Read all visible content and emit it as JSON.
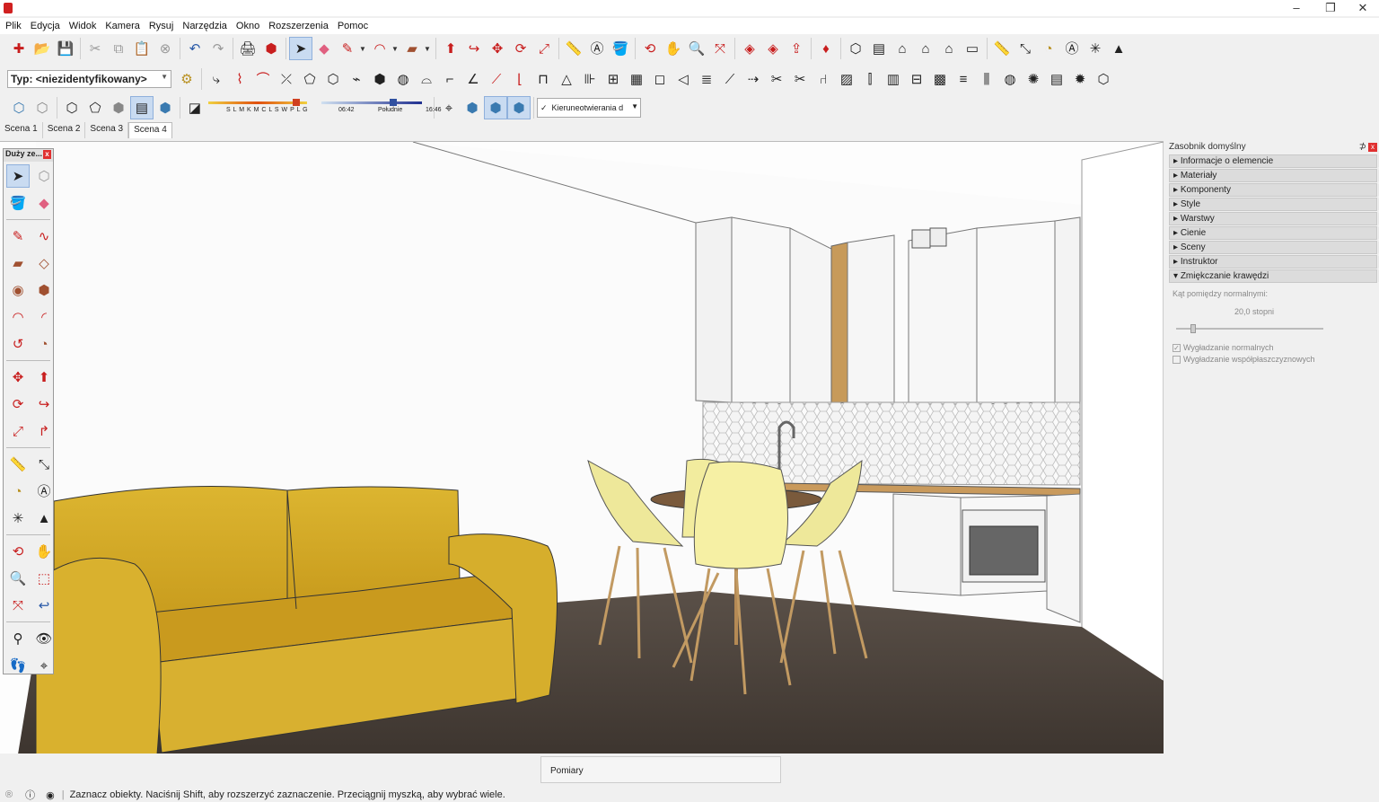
{
  "menu": [
    "Plik",
    "Edycja",
    "Widok",
    "Kamera",
    "Rysuj",
    "Narzędzia",
    "Okno",
    "Rozszerzenia",
    "Pomoc"
  ],
  "window_controls": {
    "minimize": "–",
    "restore": "❐",
    "close": "✕"
  },
  "style_type": "Typ: <niezidentyfikowany>",
  "shadow_slider": {
    "months": "S L M K M C L S W P L G",
    "time_start": "06:42",
    "time_mid": "Południe",
    "time_end": "16:46"
  },
  "section_option": {
    "check": "✓",
    "label": "Kieruneotwierania d"
  },
  "scene_tabs": [
    "Scena 1",
    "Scena 2",
    "Scena 3",
    "Scena 4"
  ],
  "active_scene": "Scena 4",
  "large_tools": {
    "title": "Duży ze...",
    "close": "x"
  },
  "tray": {
    "title": "Zasobnik domyślny",
    "pin": "⊅",
    "close": "x",
    "panels": [
      "Informacje o elemencie",
      "Materiały",
      "Komponenty",
      "Style",
      "Warstwy",
      "Cienie",
      "Sceny",
      "Instruktor",
      "Zmiękczanie krawędzi"
    ],
    "expanded": "Zmiękczanie krawędzi",
    "softening": {
      "angle_label": "Kąt pomiędzy normalnymi:",
      "angle_value": "20,0  stopni",
      "angle_fraction": 0.1,
      "smooth_normals": "Wygładzanie normalnych",
      "smooth_coplanar": "Wygładzanie współpłaszczyznowych",
      "smooth_normals_checked": true,
      "smooth_coplanar_checked": false
    }
  },
  "measurements_label": "Pomiary",
  "status_text": "Zaznacz obiekty. Naciśnij Shift, aby rozszerzyć zaznaczenie. Przeciągnij myszką, aby wybrać wiele.",
  "colors": {
    "sofa": "#d9b12a",
    "floor": "#4e453e",
    "chair": "#f3ec9c",
    "accent_red": "#c81e1e"
  }
}
